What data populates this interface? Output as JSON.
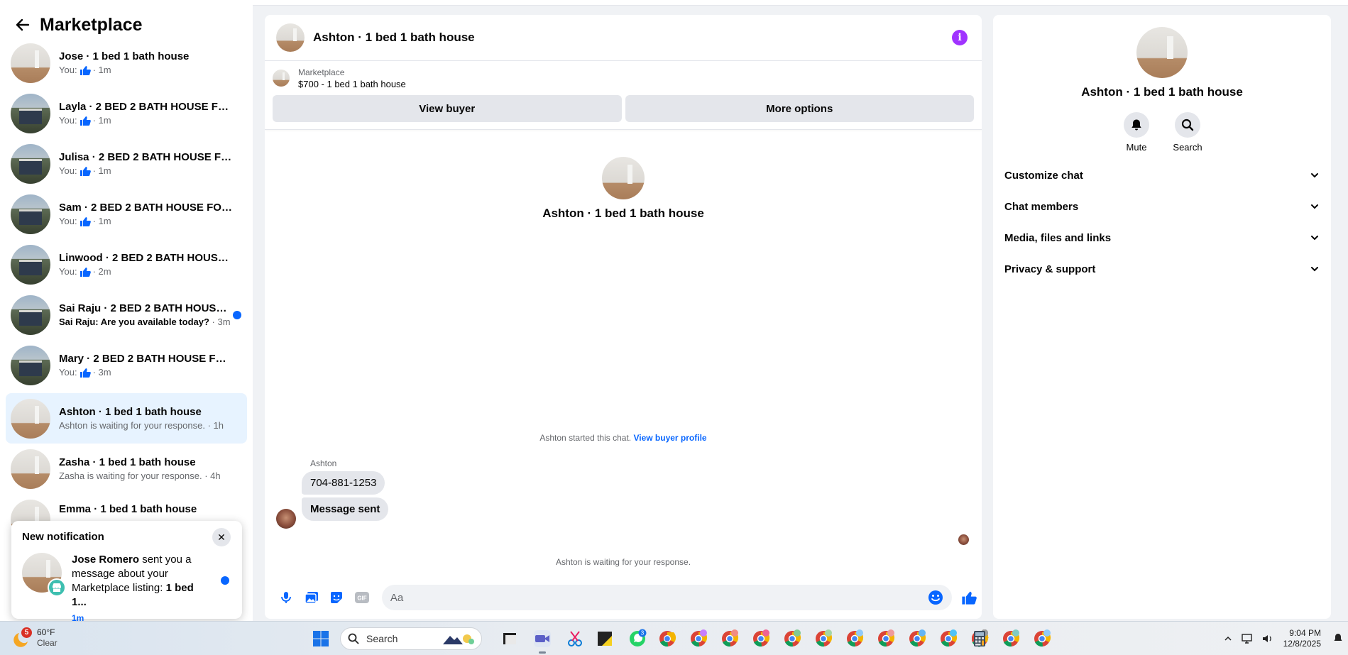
{
  "sidebar": {
    "title": "Marketplace",
    "conversations": [
      {
        "name": "Jose · 1 bed 1 bath house",
        "prefix": "You:",
        "suffix": "· 1m",
        "like": true,
        "avatar": "room"
      },
      {
        "name": "Layla · 2 BED 2 BATH HOUSE FOR ...",
        "prefix": "You:",
        "suffix": "· 1m",
        "like": true,
        "avatar": "house"
      },
      {
        "name": "Julisa · 2 BED 2 BATH HOUSE FOR ...",
        "prefix": "You:",
        "suffix": "· 1m",
        "like": true,
        "avatar": "house"
      },
      {
        "name": "Sam · 2 BED 2 BATH HOUSE FOR R...",
        "prefix": "You:",
        "suffix": "· 1m",
        "like": true,
        "avatar": "house"
      },
      {
        "name": "Linwood · 2 BED 2 BATH HOUSE F...",
        "prefix": "You:",
        "suffix": "· 2m",
        "like": true,
        "avatar": "house"
      },
      {
        "name": "Sai Raju · 2 BED 2 BATH HOUSE ...",
        "prefix": "Sai Raju: Are you available today?",
        "suffix": "· 3m",
        "like": false,
        "unread": true,
        "avatar": "house"
      },
      {
        "name": "Mary · 2 BED 2 BATH HOUSE FOR ...",
        "prefix": "You:",
        "suffix": "· 3m",
        "like": true,
        "avatar": "house"
      },
      {
        "name": "Ashton · 1 bed 1 bath house",
        "prefix": "Ashton is waiting for your response.",
        "suffix": "· 1h",
        "like": false,
        "active": true,
        "avatar": "room"
      },
      {
        "name": "Zasha · 1 bed 1 bath house",
        "prefix": "Zasha is waiting for your response.",
        "suffix": "· 4h",
        "like": false,
        "avatar": "room"
      },
      {
        "name": "Emma · 1 bed 1 bath house",
        "prefix": "",
        "suffix": "",
        "like": false,
        "avatar": "room"
      }
    ]
  },
  "notification": {
    "title": "New notification",
    "sender": "Jose Romero",
    "text_middle": " sent you a message about your Marketplace listing: ",
    "listing": "1 bed 1...",
    "time": "1m"
  },
  "chat": {
    "title": "Ashton · 1 bed 1 bath house",
    "listing_label": "Marketplace",
    "listing_price": "$700 - 1 bed 1 bath house",
    "view_buyer": "View buyer",
    "more_options": "More options",
    "intro_name": "Ashton · 1 bed 1 bath house",
    "started_text": "Ashton started this chat. ",
    "view_buyer_profile": "View buyer profile",
    "sender_label": "Ashton",
    "messages": [
      "704-881-1253",
      "Message sent"
    ],
    "waiting_text": "Ashton is waiting for your response.",
    "composer_placeholder": "Aa"
  },
  "info_panel": {
    "name": "Ashton · 1 bed 1 bath house",
    "mute": "Mute",
    "search": "Search",
    "sections": [
      "Customize chat",
      "Chat members",
      "Media, files and links",
      "Privacy & support"
    ]
  },
  "taskbar": {
    "weather_temp": "60°F",
    "weather_cond": "Clear",
    "weather_badge": "5",
    "search_label": "Search",
    "whatsapp_badge": "3",
    "time": "9:04 PM",
    "date": "12/8/2025"
  },
  "colors": {
    "accent": "#0866ff",
    "info_purple": "#a033ff",
    "active_bg": "#e7f3ff"
  }
}
